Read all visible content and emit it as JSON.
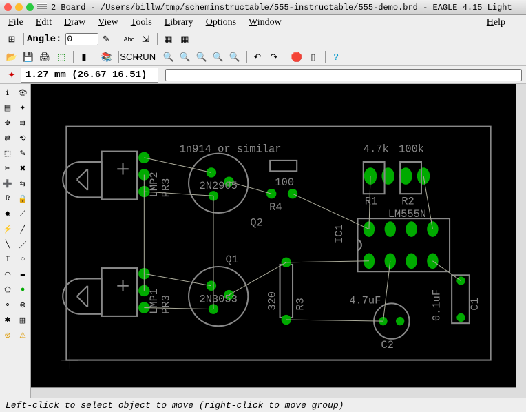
{
  "titlebar": {
    "title": "2 Board - /Users/billw/tmp/scheminstructable/555-instructable/555-demo.brd - EAGLE 4.15 Light"
  },
  "menu": {
    "file": "File",
    "edit": "Edit",
    "draw": "Draw",
    "view": "View",
    "tools": "Tools",
    "library": "Library",
    "options": "Options",
    "window": "Window",
    "help": "Help"
  },
  "toolbar_row1": {
    "angle_label": "Angle:",
    "angle_value": "0",
    "abc_label": "Abc"
  },
  "toolbar_row2": {
    "coord_display": "1.27 mm (26.67 16.51)"
  },
  "statusbar": {
    "message": "Left-click to select object to move (right-click to move group)"
  },
  "schematic": {
    "labels": {
      "diode_note": "1n914 or similar",
      "r1_val": "4.7k",
      "r2_val": "100k",
      "r1": "R1",
      "r2": "R2",
      "q1": "Q1",
      "q2": "Q2",
      "q1_part": "2N3053",
      "q2_part": "2N2905",
      "lmp1": "LMP1",
      "lmp2": "LMP2",
      "pr3a": "PR3",
      "pr3b": "PR3",
      "r3": "R3",
      "r3_val": "320",
      "r4": "R4",
      "r4_val": "100",
      "ic1": "IC1",
      "ic1_part": "LM555N",
      "c1": "C1",
      "c1_val": "0.1uF",
      "c2": "C2",
      "c2_val": "4.7uF"
    }
  }
}
